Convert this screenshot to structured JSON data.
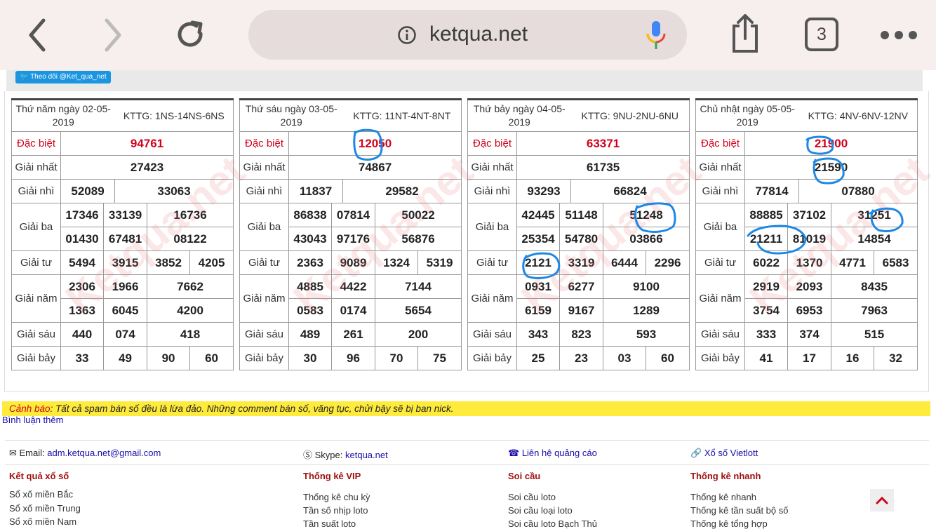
{
  "browser": {
    "url": "ketqua.net",
    "tab_count": "3",
    "icons": [
      "back-icon",
      "forward-icon",
      "reload-icon",
      "info-icon",
      "microphone-icon",
      "share-icon",
      "tabs-icon",
      "more-icon"
    ]
  },
  "twitter_button": "Theo dõi @Ket_qua_net",
  "results": [
    {
      "date": "Thứ năm ngày 02-05-2019",
      "kttg": "KTTG: 1NS-14NS-6NS",
      "dac_biet": "94761",
      "giai_nhat": "27423",
      "giai_nhi": [
        "52089",
        "33063"
      ],
      "giai_ba": [
        "17346",
        "33139",
        "16736",
        "01430",
        "67481",
        "08122"
      ],
      "giai_tu": [
        "5494",
        "3915",
        "3852",
        "4205"
      ],
      "giai_nam": [
        "2306",
        "1966",
        "7662",
        "1363",
        "6045",
        "4200"
      ],
      "giai_sau": [
        "440",
        "074",
        "418"
      ],
      "giai_bay": [
        "33",
        "49",
        "90",
        "60"
      ]
    },
    {
      "date": "Thứ sáu ngày 03-05-2019",
      "kttg": "KTTG: 11NT-4NT-8NT",
      "dac_biet": "12050",
      "giai_nhat": "74867",
      "giai_nhi": [
        "11837",
        "29582"
      ],
      "giai_ba": [
        "86838",
        "07814",
        "50022",
        "43043",
        "97176",
        "56876"
      ],
      "giai_tu": [
        "2363",
        "9089",
        "1324",
        "5319"
      ],
      "giai_nam": [
        "4885",
        "4422",
        "7144",
        "0583",
        "0174",
        "5654"
      ],
      "giai_sau": [
        "489",
        "261",
        "200"
      ],
      "giai_bay": [
        "30",
        "96",
        "70",
        "75"
      ]
    },
    {
      "date": "Thứ bảy ngày 04-05-2019",
      "kttg": "KTTG: 9NU-2NU-6NU",
      "dac_biet": "63371",
      "giai_nhat": "61735",
      "giai_nhi": [
        "93293",
        "66824"
      ],
      "giai_ba": [
        "42445",
        "51148",
        "51248",
        "25354",
        "54780",
        "03866"
      ],
      "giai_tu": [
        "2121",
        "3319",
        "6444",
        "2296"
      ],
      "giai_nam": [
        "0931",
        "6277",
        "9100",
        "6159",
        "9167",
        "1289"
      ],
      "giai_sau": [
        "343",
        "823",
        "593"
      ],
      "giai_bay": [
        "25",
        "23",
        "03",
        "60"
      ]
    },
    {
      "date": "Chủ nhật ngày 05-05-2019",
      "kttg": "KTTG: 4NV-6NV-12NV",
      "dac_biet": "21900",
      "giai_nhat": "21590",
      "giai_nhi": [
        "77814",
        "07880"
      ],
      "giai_ba": [
        "88885",
        "37102",
        "31251",
        "21211",
        "81019",
        "14854"
      ],
      "giai_tu": [
        "6022",
        "1370",
        "4771",
        "6583"
      ],
      "giai_nam": [
        "2919",
        "2093",
        "8435",
        "3754",
        "6953",
        "7963"
      ],
      "giai_sau": [
        "333",
        "374",
        "515"
      ],
      "giai_bay": [
        "41",
        "17",
        "16",
        "32"
      ]
    }
  ],
  "labels": {
    "dac_biet": "Đặc biệt",
    "giai_nhat": "Giải nhất",
    "giai_nhi": "Giải nhì",
    "giai_ba": "Giải ba",
    "giai_tu": "Giải tư",
    "giai_nam": "Giải năm",
    "giai_sau": "Giải sáu",
    "giai_bay": "Giải bảy"
  },
  "watermark": "Ketqua.net",
  "warning": {
    "title": "Cảnh báo",
    "text": ": Tất cả spam bán số đều là lừa đảo. Những comment bán số, văng tục, chửi bậy sẽ bị ban nick."
  },
  "more_comments": "Bình luận thêm",
  "contact": {
    "email_label": "Email:",
    "email": "adm.ketqua.net@gmail.com",
    "skype_label": "Skype:",
    "skype": "ketqua.net",
    "ads": "Liên hệ quảng cáo",
    "vietlott": "Xổ số Vietlott"
  },
  "footer": {
    "col1": {
      "title": "Kết quả xổ số",
      "links": [
        "Sổ xố miền Bắc",
        "Sổ xố miền Trung",
        "Sổ xố miền Nam"
      ]
    },
    "col2": {
      "title": "Thống kê VIP",
      "links": [
        "Thống kê chu kỳ",
        "Tần số nhịp loto",
        "Tần suất loto"
      ]
    },
    "col3": {
      "title": "Soi cầu",
      "links": [
        "Soi cầu loto",
        "Soi cầu loại loto",
        "Soi cầu loto Bạch Thủ"
      ]
    },
    "col4": {
      "title": "Thống kê nhanh",
      "links": [
        "Thống kê nhanh",
        "Thống kê tần suất bộ số",
        "Thống kê tổng hợp"
      ]
    }
  },
  "colors": {
    "accent_red": "#d0021b",
    "link_blue": "#1a0dab",
    "warning_yellow": "#ffeb3b",
    "marker_blue": "#1e88e5"
  }
}
